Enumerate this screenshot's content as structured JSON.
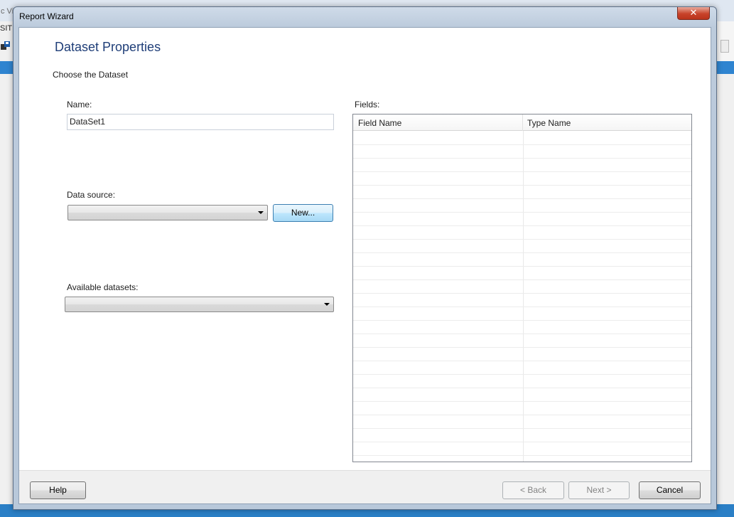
{
  "background_app": {
    "title_fragment": "c Vi",
    "menu_fragment": "SITI"
  },
  "wizard": {
    "window_title": "Report Wizard",
    "close_glyph": "✕",
    "page_title": "Dataset Properties",
    "page_subtitle": "Choose the Dataset",
    "name_label": "Name:",
    "name_value": "DataSet1",
    "data_source_label": "Data source:",
    "data_source_value": "",
    "new_button": "New...",
    "available_datasets_label": "Available datasets:",
    "available_datasets_value": "",
    "fields_label": "Fields:",
    "fields_columns": [
      "Field Name",
      "Type Name"
    ],
    "fields_rows": [],
    "footer": {
      "help": "Help",
      "back": "< Back",
      "next": "Next >",
      "cancel": "Cancel"
    }
  },
  "colors": {
    "title_blue": "#1f3e78",
    "close_red": "#c8432a",
    "hot_button": "#bee6fd"
  }
}
